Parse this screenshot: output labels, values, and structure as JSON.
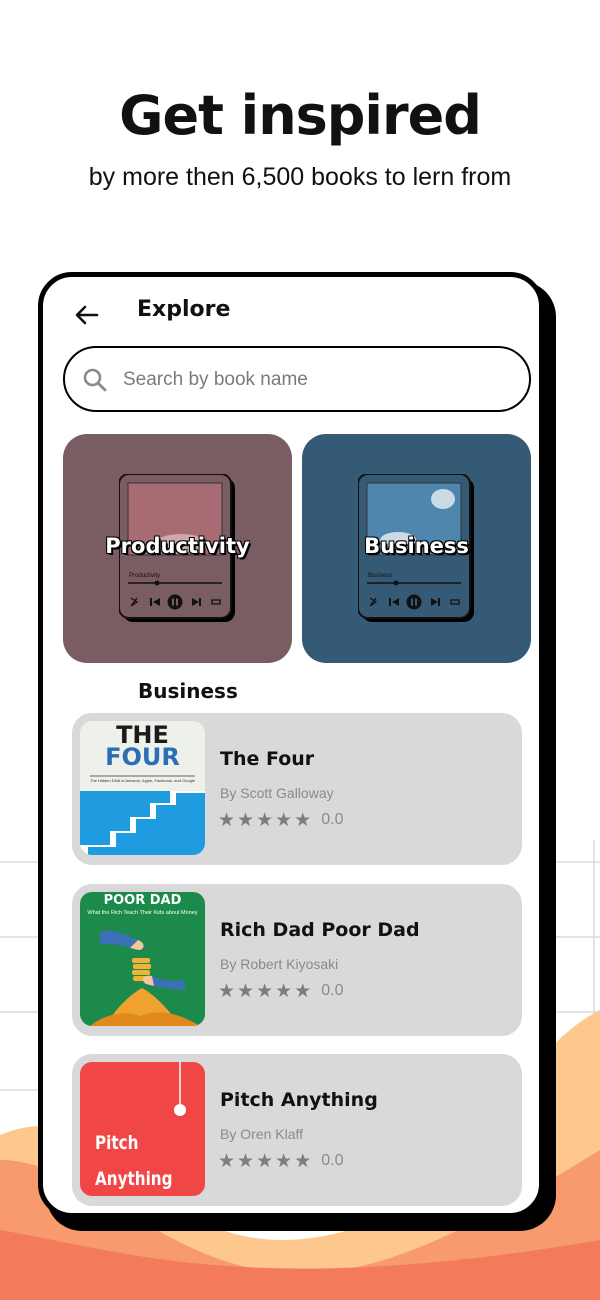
{
  "hero": {
    "title": "Get inspired",
    "subtitle": "by more then 6,500 books to lern from"
  },
  "screen": {
    "title": "Explore",
    "search_placeholder": "Search by book name",
    "categories": [
      {
        "label": "Productivity",
        "player_caption": "Productivity",
        "color": "#7a5d62"
      },
      {
        "label": "Business",
        "player_caption": "Business",
        "color": "#355a76"
      }
    ],
    "section_title": "Business",
    "books": [
      {
        "title": "The Four",
        "author": "By Scott Galloway",
        "rating": "0.0",
        "stars": 0,
        "cover": {
          "line1": "THE",
          "line2": "FOUR",
          "tagline": "The Hidden DNA of Amazon, Apple, Facebook, and Google"
        }
      },
      {
        "title": "Rich Dad Poor Dad",
        "author": "By Robert Kiyosaki",
        "rating": "0.0",
        "stars": 0,
        "cover": {
          "line1": "POOR DAD",
          "tagline": "What the Rich Teach Their Kids about Money"
        }
      },
      {
        "title": "Pitch Anything",
        "author": "By Oren Klaff",
        "rating": "0.0",
        "stars": 0,
        "cover": {
          "line1": "Pitch",
          "line2": "Anything"
        }
      }
    ]
  },
  "colors": {
    "accent_orange": "#f5946a",
    "card_bg": "#d9d9d9"
  }
}
